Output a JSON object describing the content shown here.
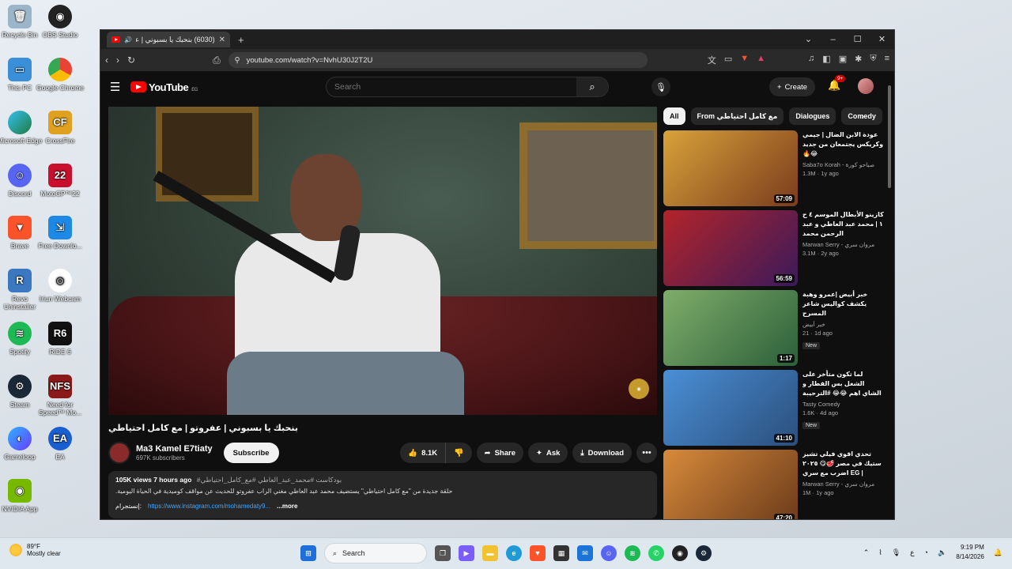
{
  "desktop": {
    "icons": [
      {
        "label": "Recycle Bin",
        "x": 0,
        "y": 0
      },
      {
        "label": "OBS Studio"
      },
      {
        "label": "This PC"
      },
      {
        "label": "Google Chrome"
      },
      {
        "label": "Microsoft Edge"
      },
      {
        "label": "CrossFire"
      },
      {
        "label": "Discord"
      },
      {
        "label": "MotoGP™22"
      },
      {
        "label": "Brave"
      },
      {
        "label": "Free Downlo..."
      },
      {
        "label": "Revo Uninstaller"
      },
      {
        "label": "Iriun Webcam"
      },
      {
        "label": "Spotify"
      },
      {
        "label": "RIDE 6"
      },
      {
        "label": "Steam"
      },
      {
        "label": "Need for Speed™ Mo..."
      },
      {
        "label": "Gameloop"
      },
      {
        "label": "EA"
      },
      {
        "label": "NVIDIA App"
      }
    ]
  },
  "browser": {
    "tab_title": "(6030) بنحبك يا بسبوني | عفرو...",
    "tab_close": "✕",
    "new_tab": "+",
    "url": "youtube.com/watch?v=NvhU30J2T2U",
    "controls": {
      "minimize": "–",
      "maximize": "☐",
      "close": "✕",
      "dropdown": "⌄"
    }
  },
  "youtube": {
    "logo_text": "YouTube",
    "region": "EG",
    "search_placeholder": "Search",
    "create_label": "Create",
    "notifications_badge": "9+",
    "video": {
      "title": "بنحبك يا بسبوني | عفروتو | مع كامل احتياطي",
      "channel": "Ma3 Kamel E7tiaty",
      "subscribers": "697K subscribers",
      "subscribe_label": "Subscribe",
      "likes": "8.1K",
      "share_label": "Share",
      "ask_label": "Ask",
      "download_label": "Download",
      "views": "105K views",
      "posted": "7 hours ago",
      "hashtags": "#بودكاست #محمد_عبد_العاطي #مع_كامل_احتياطي",
      "description": "حلقة جديدة من \"مع كامل احتياطي\" يستضيف محمد عبد العاطي مغني الراب عفروتو للحديث عن مواقف كوميدية في الحياة اليومية.",
      "link_prefix": "إنستجرام:",
      "link": "https://www.instagram.com/mohamedaty9...",
      "more_label": "...more"
    },
    "chips": [
      "All",
      "From مع كامل احتياطي",
      "Dialogues",
      "Comedy"
    ],
    "recommendations": [
      {
        "title": "عودة الابن الضال | جيمي وكريكس يجتمعان من جديد 😂🔥",
        "channel": "Saba7o Korah - صباحو كورة",
        "stats": "1.3M · 1y ago",
        "duration": "57:09",
        "color1": "#d9a23a",
        "color2": "#7a3b1d",
        "new": ""
      },
      {
        "title": "كازينو الأبطال الموسم ٤ ح ١ | محمد عبد العاطي و عبد الرحمن محمد",
        "channel": "Marwan Serry - مروان سري",
        "stats": "3.1M · 2y ago",
        "duration": "56:59",
        "color1": "#b3242a",
        "color2": "#3a1a5a",
        "new": ""
      },
      {
        "title": "خبر أبيض |عمرو وهبة يكشف كواليس شاعر المسرح",
        "channel": "خبر أبيض",
        "stats": "21 · 1d ago",
        "duration": "1:17",
        "color1": "#7fae6a",
        "color2": "#2c5f3a",
        "new": "New"
      },
      {
        "title": "لما تكون متأخر على الشغل بس الفطار و الشاي اهم 😂😂 #الترحيبة",
        "channel": "Tasty Comedy",
        "stats": "1.6K · 4d ago",
        "duration": "41:10",
        "color1": "#4a8fd6",
        "color2": "#2b4f7c",
        "new": "New"
      },
      {
        "title": "تحدي اقوي فيلي تشيز ستيك في مصر 🥩😋 ٢٠٢٥ | EG اضرب مع سري",
        "channel": "Marwan Serry - مروان سري",
        "stats": "1M · 1y ago",
        "duration": "47:20",
        "color1": "#d88a3a",
        "color2": "#6a3a1a",
        "new": ""
      }
    ]
  },
  "taskbar": {
    "temperature": "89°F",
    "weather": "Mostly clear",
    "search_label": "Search",
    "time": "9:19 PM",
    "date": "8/14/2026"
  }
}
